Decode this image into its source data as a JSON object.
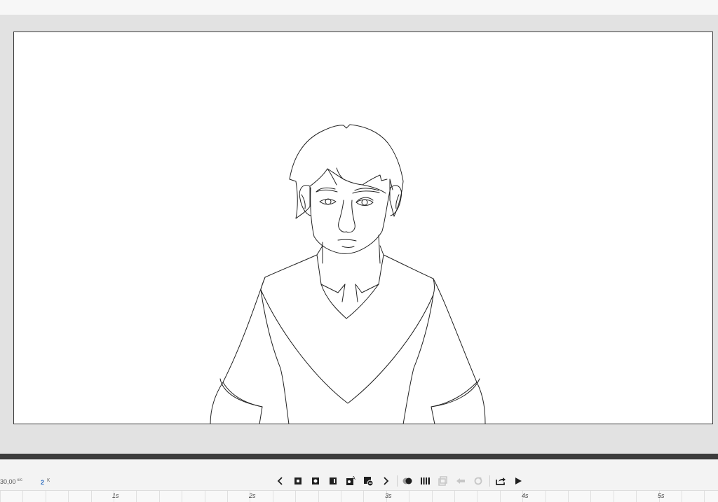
{
  "timeline": {
    "frame_rate": "30,00",
    "frame_rate_unit": "к/с",
    "onion_skin_count": "2",
    "onion_skin_unit": "К",
    "seconds": [
      "1s",
      "2s",
      "3s",
      "4s",
      "5s"
    ]
  },
  "toolbar": {
    "buttons": [
      {
        "name": "prev-frame-button",
        "icon": "chevron-left-icon",
        "enabled": true
      },
      {
        "name": "insert-blank-keyframe-button",
        "icon": "blank-keyframe-icon",
        "enabled": true
      },
      {
        "name": "insert-keyframe-button",
        "icon": "keyframe-icon",
        "enabled": true
      },
      {
        "name": "insert-frame-button",
        "icon": "frame-icon",
        "enabled": true
      },
      {
        "name": "add-auto-keyframe-button",
        "icon": "auto-keyframe-icon",
        "enabled": true
      },
      {
        "name": "remove-frame-button",
        "icon": "remove-frame-icon",
        "enabled": true
      },
      {
        "name": "next-frame-button",
        "icon": "chevron-right-icon",
        "enabled": true
      },
      {
        "name": "onion-skin-button",
        "icon": "onion-skin-icon",
        "enabled": true
      },
      {
        "name": "multi-frame-button",
        "icon": "multi-frame-icon",
        "enabled": true
      },
      {
        "name": "edit-multiple-frames-button",
        "icon": "edit-frames-icon",
        "enabled": false
      },
      {
        "name": "link-frames-button",
        "icon": "link-icon",
        "enabled": false
      },
      {
        "name": "loop-button",
        "icon": "loop-icon",
        "enabled": false
      },
      {
        "name": "export-button",
        "icon": "share-icon",
        "enabled": true
      },
      {
        "name": "play-button",
        "icon": "play-icon",
        "enabled": true
      }
    ]
  },
  "colors": {
    "stage": "#e2e2e2",
    "canvas": "#ffffff",
    "divider": "#3c3c3c",
    "icon": "#1f1f1f",
    "icon_disabled": "#c6c6c6",
    "accent": "#2f6fc0"
  }
}
